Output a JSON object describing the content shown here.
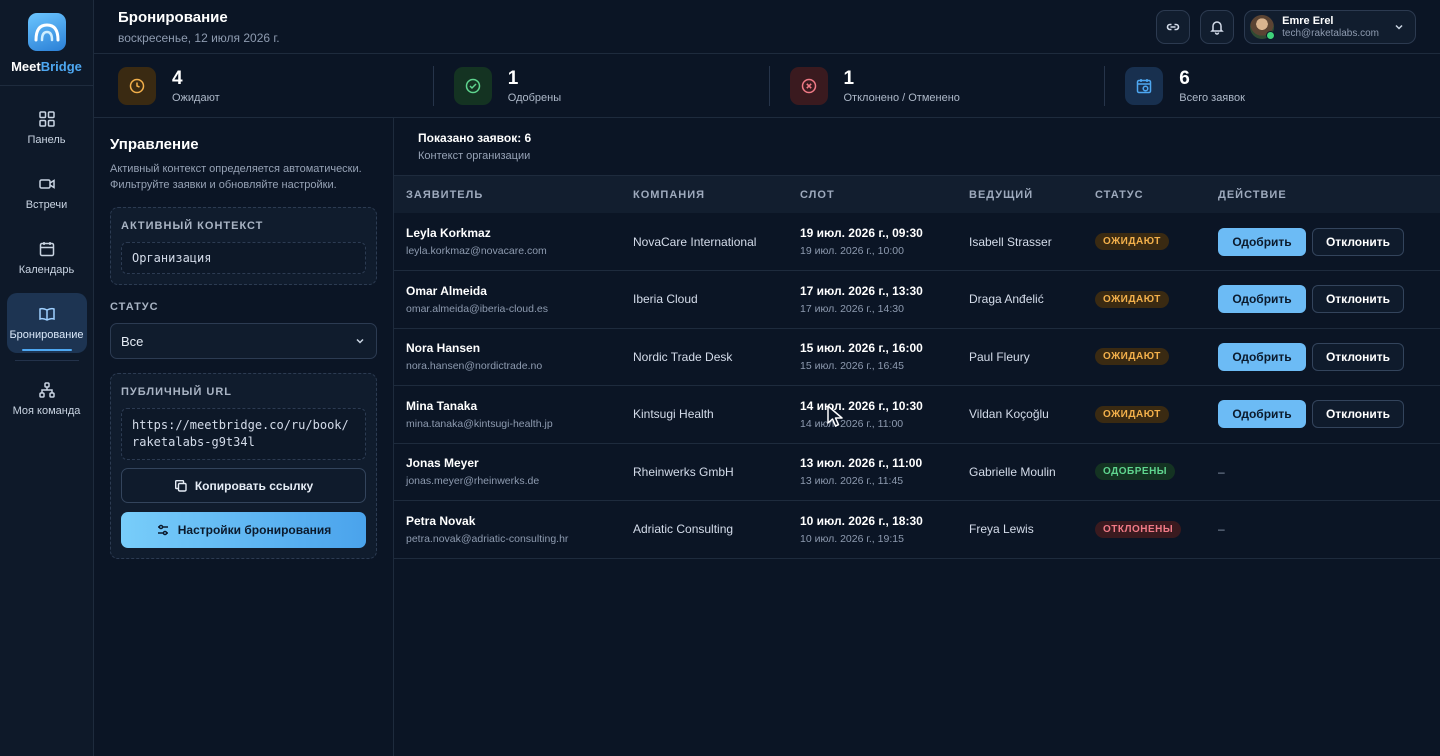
{
  "brand": {
    "name_part1": "Meet",
    "name_part2": "Bridge"
  },
  "sidebar": {
    "items": [
      {
        "label": "Панель",
        "icon": "grid-icon"
      },
      {
        "label": "Встречи",
        "icon": "video-icon"
      },
      {
        "label": "Календарь",
        "icon": "calendar-icon"
      },
      {
        "label": "Бронирование",
        "icon": "book-icon",
        "active": true
      },
      {
        "label": "Моя команда",
        "icon": "team-icon"
      }
    ]
  },
  "header": {
    "title": "Бронирование",
    "date": "воскресенье, 12 июля 2026 г.",
    "user": {
      "name": "Emre Erel",
      "email": "tech@raketalabs.com"
    }
  },
  "stats": [
    {
      "value": "4",
      "label": "Ожидают",
      "icon": "clock-icon",
      "color": "#f3b04b"
    },
    {
      "value": "1",
      "label": "Одобрены",
      "icon": "check-circle-icon",
      "color": "#5fd58f"
    },
    {
      "value": "1",
      "label": "Отклонено / Отменено",
      "icon": "x-circle-icon",
      "color": "#f07a86"
    },
    {
      "value": "6",
      "label": "Всего заявок",
      "icon": "calendar-clock-icon",
      "color": "#4ea8f2"
    }
  ],
  "panel": {
    "title": "Управление",
    "description": "Активный контекст определяется автоматически. Фильтруйте заявки и обновляйте настройки.",
    "context_label": "АКТИВНЫЙ КОНТЕКСТ",
    "context_value": "Организация",
    "status_label": "СТАТУС",
    "status_value": "Все",
    "url_label": "ПУБЛИЧНЫЙ URL",
    "url_value": "https://meetbridge.co/ru/book/raketalabs-g9t34l",
    "copy_label": "Копировать ссылку",
    "settings_label": "Настройки бронирования"
  },
  "table": {
    "shown": "Показано заявок: 6",
    "context": "Контекст организации",
    "columns": [
      "ЗАЯВИТЕЛЬ",
      "КОМПАНИЯ",
      "СЛОТ",
      "ВЕДУЩИЙ",
      "СТАТУС",
      "ДЕЙСТВИЕ"
    ],
    "approve_label": "Одобрить",
    "reject_label": "Отклонить",
    "rows": [
      {
        "name": "Leyla Korkmaz",
        "email": "leyla.korkmaz@novacare.com",
        "company": "NovaCare International",
        "slot_start": "19 июл. 2026 г., 09:30",
        "slot_end": "19 июл. 2026 г., 10:00",
        "host": "Isabell Strasser",
        "status": "ОЖИДАЮТ",
        "status_type": "pending"
      },
      {
        "name": "Omar Almeida",
        "email": "omar.almeida@iberia-cloud.es",
        "company": "Iberia Cloud",
        "slot_start": "17 июл. 2026 г., 13:30",
        "slot_end": "17 июл. 2026 г., 14:30",
        "host": "Draga Anđelić",
        "status": "ОЖИДАЮТ",
        "status_type": "pending"
      },
      {
        "name": "Nora Hansen",
        "email": "nora.hansen@nordictrade.no",
        "company": "Nordic Trade Desk",
        "slot_start": "15 июл. 2026 г., 16:00",
        "slot_end": "15 июл. 2026 г., 16:45",
        "host": "Paul Fleury",
        "status": "ОЖИДАЮТ",
        "status_type": "pending"
      },
      {
        "name": "Mina Tanaka",
        "email": "mina.tanaka@kintsugi-health.jp",
        "company": "Kintsugi Health",
        "slot_start": "14 июл. 2026 г., 10:30",
        "slot_end": "14 июл. 2026 г., 11:00",
        "host": "Vildan Koçoğlu",
        "status": "ОЖИДАЮТ",
        "status_type": "pending"
      },
      {
        "name": "Jonas Meyer",
        "email": "jonas.meyer@rheinwerks.de",
        "company": "Rheinwerks GmbH",
        "slot_start": "13 июл. 2026 г., 11:00",
        "slot_end": "13 июл. 2026 г., 11:45",
        "host": "Gabrielle Moulin",
        "status": "ОДОБРЕНЫ",
        "status_type": "approved",
        "action": "–"
      },
      {
        "name": "Petra Novak",
        "email": "petra.novak@adriatic-consulting.hr",
        "company": "Adriatic Consulting",
        "slot_start": "10 июл. 2026 г., 18:30",
        "slot_end": "10 июл. 2026 г., 19:15",
        "host": "Freya Lewis",
        "status": "ОТКЛОНЕНЫ",
        "status_type": "rejected",
        "action": "–"
      }
    ]
  }
}
